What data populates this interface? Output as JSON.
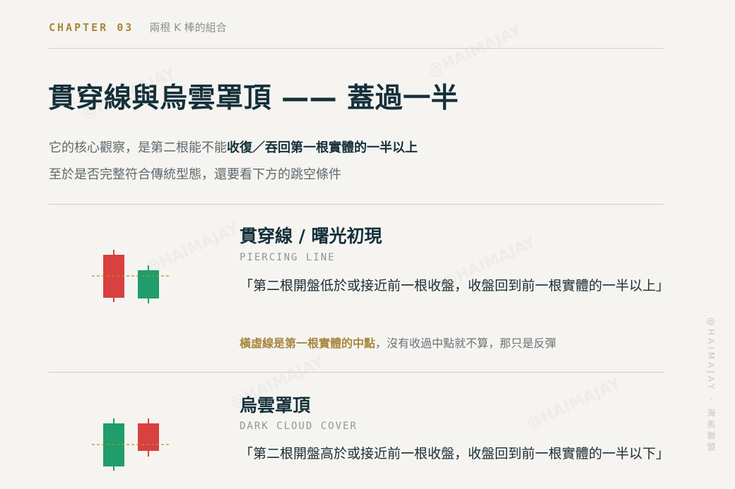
{
  "header": {
    "chapter": "CHAPTER 03",
    "subtitle": "兩根 K 棒的組合"
  },
  "title": "貫穿線與烏雲罩頂 —— 蓋過一半",
  "intro": {
    "line1_plain": "它的核心觀察，是第二根能不能",
    "line1_bold": "收復／吞回第一根實體的一半以上",
    "line2": "至於是否完整符合傳統型態，還要看下方的跳空條件"
  },
  "sections": [
    {
      "title": "貫穿線 / 曙光初現",
      "subtitle_en": "PIERCING LINE",
      "quote": "「第二根開盤低於或接近前一根收盤，收盤回到前一根實體的一半以上」",
      "note_highlight": "橫虛線是第一根實體的中點",
      "note_rest": "，沒有收過中點就不算，那只是反彈"
    },
    {
      "title": "烏雲罩頂",
      "subtitle_en": "DARK CLOUD COVER",
      "quote": "「第二根開盤高於或接近前一根收盤，收盤回到前一根實體的一半以下」"
    }
  ],
  "candles": {
    "piercing": [
      {
        "color": "#d94040"
      },
      {
        "color": "#1f9d6a"
      }
    ],
    "dark_cloud": [
      {
        "color": "#1f9d6a"
      },
      {
        "color": "#d94040"
      }
    ],
    "midline_color": "#b48a2c"
  },
  "side_watermark": "@HAIMAJAY · 海馬聯盟",
  "watermark_text": "@HAIMAJAY"
}
